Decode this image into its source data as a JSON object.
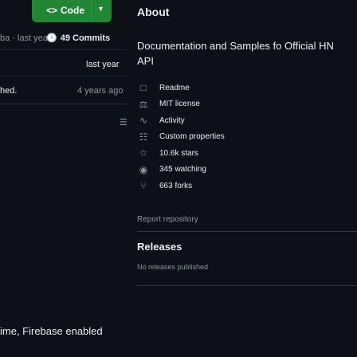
{
  "header": {
    "code_button_label": "Code",
    "about_title": "About"
  },
  "left": {
    "last_commit_text": "ba · last year",
    "commit_count": "49 Commits",
    "col_time_header": "last year",
    "row1_name": "hed.",
    "row1_time": "4 years ago",
    "commit_message": "ime, Firebase enabled"
  },
  "about": {
    "description": "Documentation and Samples fo Official HN API",
    "stats": [
      {
        "icon": "book-icon",
        "glyph": "□",
        "label": "Readme"
      },
      {
        "icon": "law-icon",
        "glyph": "⚖",
        "label": "MIT license"
      },
      {
        "icon": "pulse-icon",
        "glyph": "∿",
        "label": "Activity"
      },
      {
        "icon": "custom-properties-icon",
        "glyph": "☷",
        "label": "Custom properties"
      },
      {
        "icon": "star-icon",
        "glyph": "☆",
        "label": "10.6k stars"
      },
      {
        "icon": "eye-icon",
        "glyph": "◉",
        "label": "345 watching"
      },
      {
        "icon": "fork-icon",
        "glyph": "⑂",
        "label": "663 forks"
      }
    ],
    "report": "Report repository",
    "releases_title": "Releases",
    "no_releases": "No releases published"
  }
}
